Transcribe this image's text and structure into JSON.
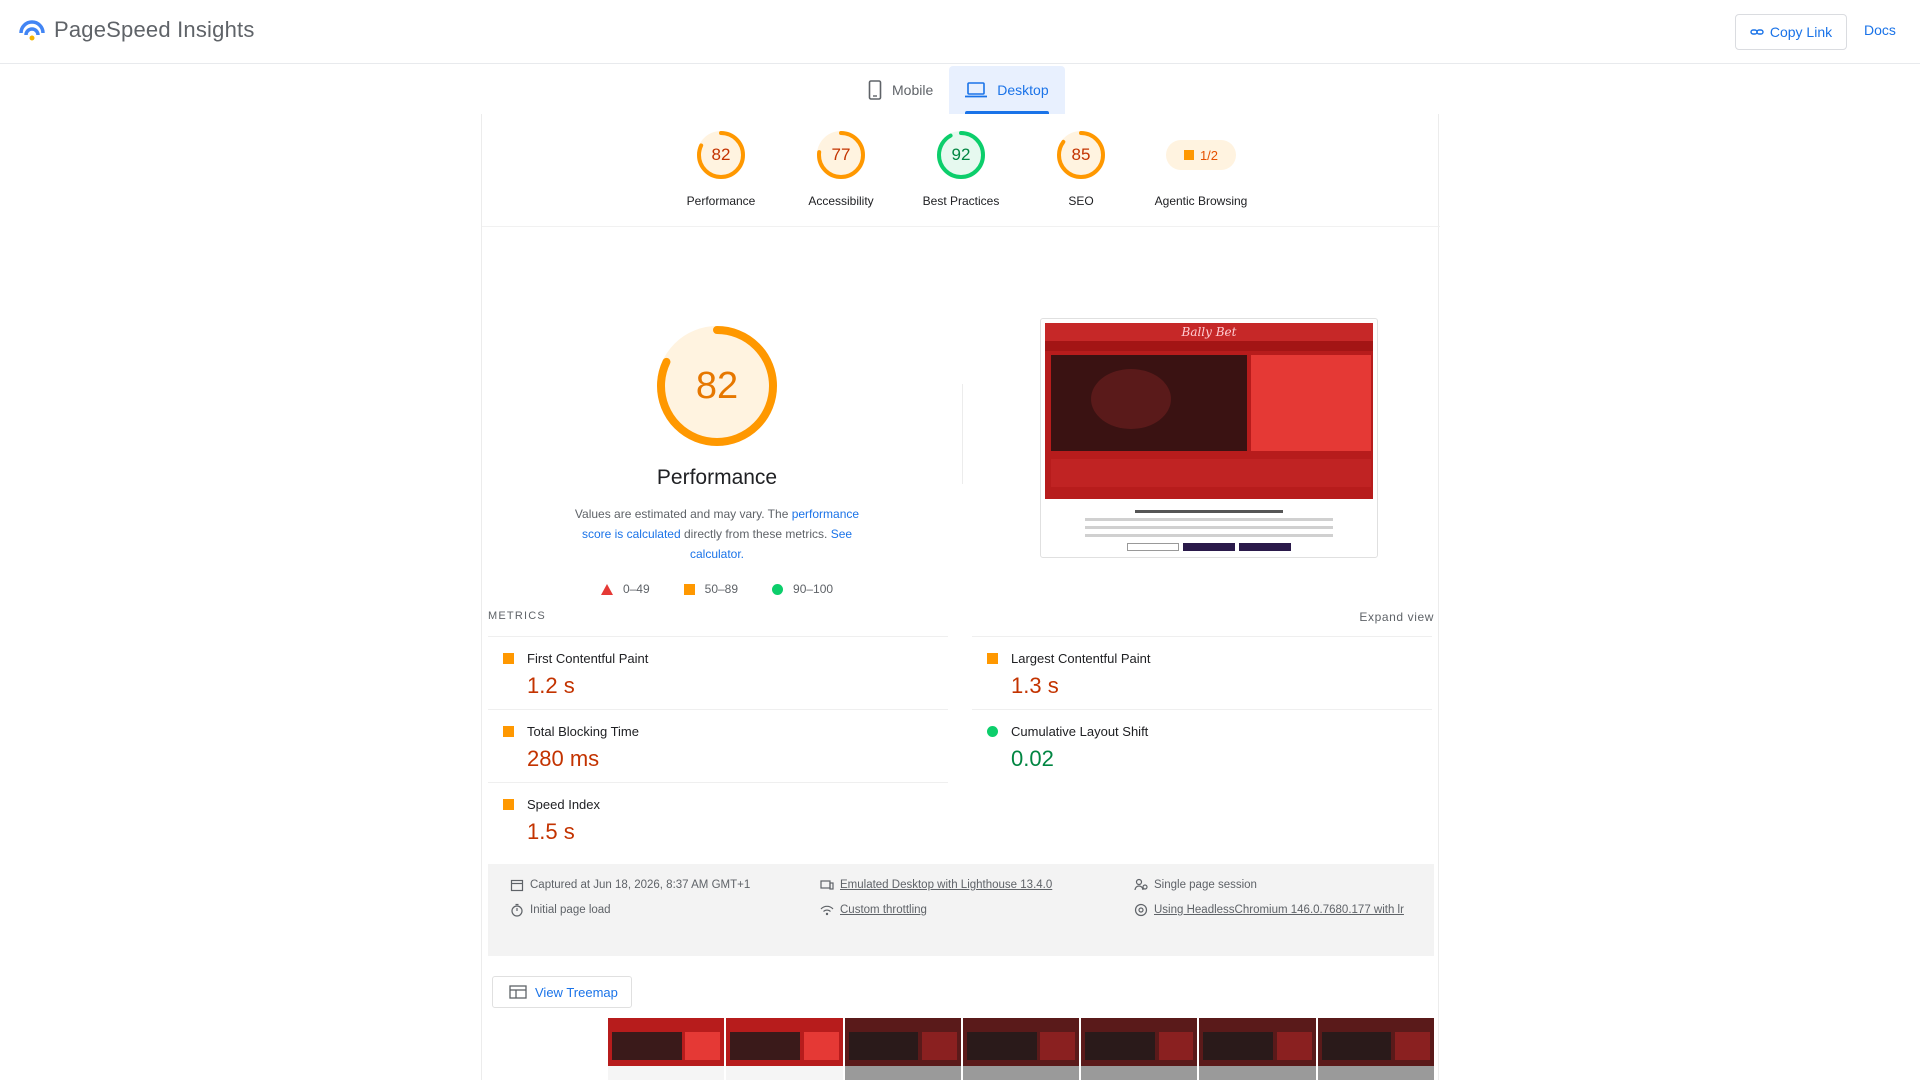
{
  "header": {
    "brand": "PageSpeed Insights",
    "copy_link": "Copy Link",
    "docs": "Docs"
  },
  "tabs": [
    {
      "label": "Mobile",
      "icon": "smartphone-icon",
      "active": false
    },
    {
      "label": "Desktop",
      "icon": "laptop-icon",
      "active": true
    }
  ],
  "gauges": [
    {
      "value": "82",
      "label": "Performance",
      "score": 82,
      "color": "#ff9800",
      "text_color": "#c33300"
    },
    {
      "value": "77",
      "label": "Accessibility",
      "score": 77,
      "color": "#ff9800",
      "text_color": "#c33300"
    },
    {
      "value": "92",
      "label": "Best Practices",
      "score": 92,
      "color": "#0cce6b",
      "text_color": "#018642"
    },
    {
      "value": "85",
      "label": "SEO",
      "score": 85,
      "color": "#ff9800",
      "text_color": "#c33300"
    }
  ],
  "agentic": {
    "label": "Agentic Browsing",
    "value": "1/2"
  },
  "performance": {
    "score": "82",
    "score_num": 82,
    "title": "Performance",
    "desc_1": "Values are estimated and may vary. The ",
    "desc_link_1": "performance score is calculated",
    "desc_2": " directly from these metrics. ",
    "desc_link_2": "See calculator."
  },
  "legend": [
    {
      "shape": "triangle",
      "label": "0–49",
      "color": "#e53935"
    },
    {
      "shape": "square",
      "label": "50–89",
      "color": "#ff9800"
    },
    {
      "shape": "circle",
      "label": "90–100",
      "color": "#0cce6b"
    }
  ],
  "thumbnail": {
    "logo": "Bally Bet"
  },
  "metrics": {
    "heading": "METRICS",
    "expand": "Expand view",
    "items": [
      {
        "name": "First Contentful Paint",
        "value": "1.2 s",
        "status": "average"
      },
      {
        "name": "Largest Contentful Paint",
        "value": "1.3 s",
        "status": "average"
      },
      {
        "name": "Total Blocking Time",
        "value": "280 ms",
        "status": "average"
      },
      {
        "name": "Cumulative Layout Shift",
        "value": "0.02",
        "status": "pass"
      },
      {
        "name": "Speed Index",
        "value": "1.5 s",
        "status": "average"
      }
    ]
  },
  "runtime": {
    "captured": "Captured at Jun 18, 2026, 8:37 AM GMT+1",
    "initial_load": "Initial page load",
    "emulated": "Emulated Desktop with Lighthouse 13.4.0",
    "throttling": "Custom throttling",
    "session": "Single page session",
    "browser": "Using HeadlessChromium 146.0.7680.177 with lr"
  },
  "treemap": {
    "label": "View Treemap"
  },
  "colors": {
    "accent": "#1a73e8",
    "average": "#ff9800",
    "pass": "#0cce6b",
    "fail": "#e53935"
  }
}
